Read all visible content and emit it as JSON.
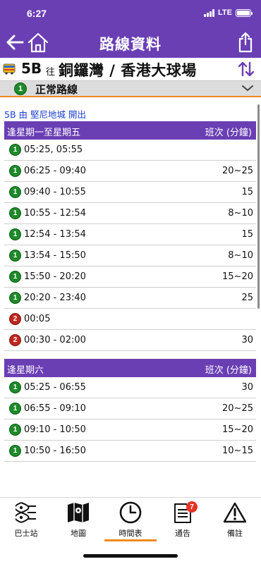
{
  "status_bar": {
    "time": "6:27",
    "network": "LTE"
  },
  "header": {
    "title": "路線資料"
  },
  "route": {
    "number": "5B",
    "to_label": "往",
    "destination": "銅鑼灣 / 香港大球場"
  },
  "variant": {
    "badge": "1",
    "label": "正常路線"
  },
  "timetable": {
    "departure_label": "5B 由 堅尼地城 開出",
    "sections": [
      {
        "days": "逢星期一至星期五",
        "freq_header": "班次 (分鐘)",
        "rows": [
          {
            "badge": "1",
            "time": "05:25, 05:55",
            "freq": ""
          },
          {
            "badge": "1",
            "time": "06:25 - 09:40",
            "freq": "20~25"
          },
          {
            "badge": "1",
            "time": "09:40 - 10:55",
            "freq": "15"
          },
          {
            "badge": "1",
            "time": "10:55 - 12:54",
            "freq": "8~10"
          },
          {
            "badge": "1",
            "time": "12:54 - 13:54",
            "freq": "15"
          },
          {
            "badge": "1",
            "time": "13:54 - 15:50",
            "freq": "8~10"
          },
          {
            "badge": "1",
            "time": "15:50 - 20:20",
            "freq": "15~20"
          },
          {
            "badge": "1",
            "time": "20:20 - 23:40",
            "freq": "25"
          },
          {
            "badge": "2",
            "time": "00:05",
            "freq": ""
          },
          {
            "badge": "2",
            "time": "00:30 - 02:00",
            "freq": "30"
          }
        ]
      },
      {
        "days": "逢星期六",
        "freq_header": "班次 (分鐘)",
        "rows": [
          {
            "badge": "1",
            "time": "05:25 - 06:55",
            "freq": "30"
          },
          {
            "badge": "1",
            "time": "06:55 - 09:10",
            "freq": "20~25"
          },
          {
            "badge": "1",
            "time": "09:10 - 10:50",
            "freq": "15~20"
          },
          {
            "badge": "1",
            "time": "10:50 - 16:50",
            "freq": "10~15"
          }
        ]
      }
    ]
  },
  "tabs": [
    {
      "label": "巴士站",
      "icon": "bus-stops-icon"
    },
    {
      "label": "地圖",
      "icon": "map-icon"
    },
    {
      "label": "時間表",
      "icon": "clock-icon",
      "active": true
    },
    {
      "label": "通告",
      "icon": "notice-icon",
      "badge": "7"
    },
    {
      "label": "備註",
      "icon": "warning-icon"
    }
  ],
  "colors": {
    "primary": "#6a3fb4",
    "accent": "#f08a1e",
    "badge_green": "#1e8a2a",
    "badge_red": "#c0281f",
    "link_blue": "#1a3fd6"
  }
}
